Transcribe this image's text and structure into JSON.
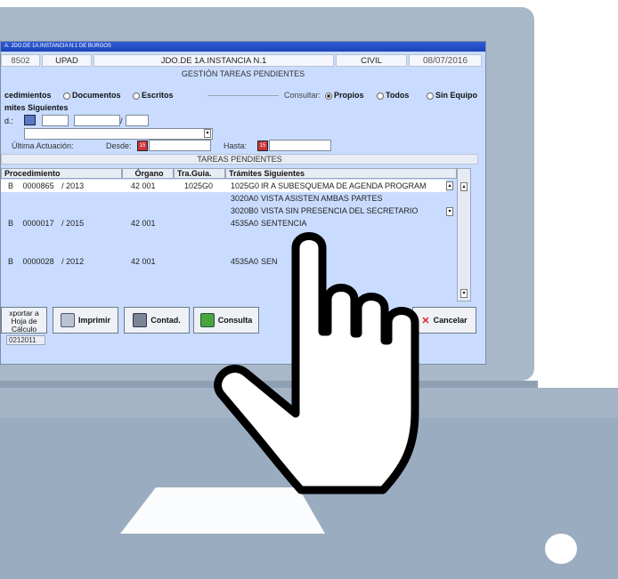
{
  "window": {
    "title": "A. JDO.DE 1A.INSTANCIA N.1 DE BURGOS",
    "field_code": "8502",
    "field_unit": "UPAD",
    "field_court": "JDO.DE 1A.INSTANCIA N.1",
    "field_type": "CIVIL",
    "field_date": "08/07/2016",
    "subtitle": "GESTIÓN TAREAS PENDIENTES"
  },
  "filters": {
    "tab_procedimientos": "cedimientos",
    "tab_documentos": "Documentos",
    "tab_escritos": "Escritos",
    "consultar_label": "Consultar:",
    "opt_propios": "Propios",
    "opt_todos": "Todos",
    "opt_sin_equipo": "Sin Equipo",
    "tramites_label": "mites Siguientes",
    "id_label": "d.:",
    "ultima_label": "Última Actuación:",
    "desde_label": "Desde:",
    "hasta_label": "Hasta:",
    "cal_icon_text": "15"
  },
  "table": {
    "title": "TAREAS PENDIENTES",
    "headers": [
      "Procedimiento",
      "Órgano",
      "Tra.Guia.",
      "Trámites Siguientes"
    ],
    "rows": [
      {
        "tipo": "B",
        "num": "0000865",
        "year": "/ 2013",
        "organo": "42  001",
        "guia": "1025G0",
        "tramites": [
          [
            "1025G0",
            "IR A SUBESQUEMA DE AGENDA PROGRAM"
          ],
          [
            "3020A0",
            "VISTA ASISTEN AMBAS PARTES"
          ],
          [
            "3020B0",
            "VISTA SIN PRESENCIA DEL SECRETARIO"
          ]
        ]
      },
      {
        "tipo": "B",
        "num": "0000017",
        "year": "/ 2015",
        "organo": "42  001",
        "guia": "",
        "tramites": [
          [
            "4535A0",
            "SENTENCIA"
          ]
        ]
      },
      {
        "tipo": "B",
        "num": "0000028",
        "year": "/ 2012",
        "organo": "42  001",
        "guia": "",
        "tramites": [
          [
            "4535A0",
            "SEN"
          ]
        ]
      }
    ]
  },
  "buttons": {
    "exportar_1": "xportar a",
    "exportar_2": "Hoja de",
    "exportar_3": "Cálculo",
    "imprimir": "Imprimir",
    "contad": "Contad.",
    "consulta": "Consulta",
    "cancelar": "Cancelar"
  },
  "status": {
    "code": "0212011"
  },
  "icons": [
    "calendar-icon",
    "printer-icon",
    "calculator-icon",
    "consulta-icon",
    "cancel-icon",
    "hand-pointer-icon"
  ]
}
